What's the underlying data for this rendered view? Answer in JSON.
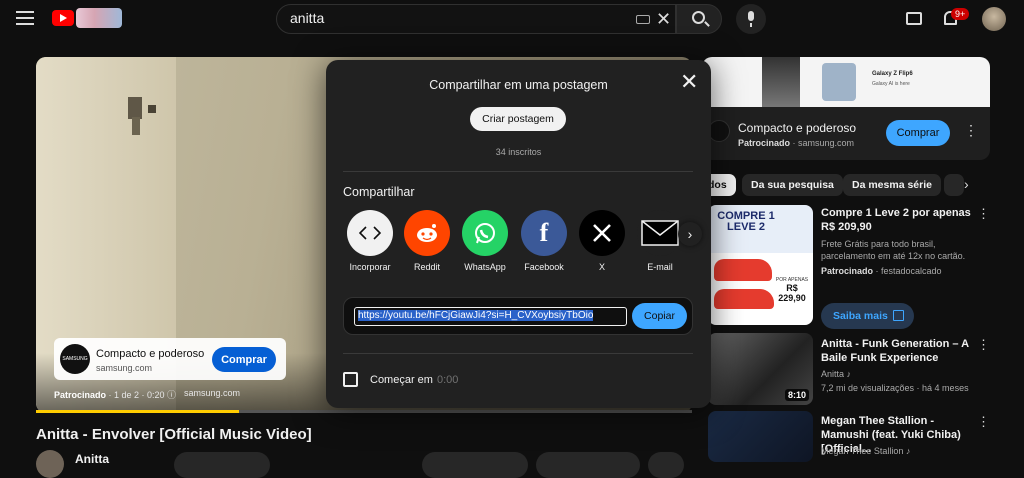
{
  "header": {
    "search_value": "anitta",
    "notification_count": "9+"
  },
  "video": {
    "title": "Anitta - Envolver [Official Music Video]",
    "channel": "Anitta",
    "progress_fraction": 0.31,
    "ad": {
      "logo_text": "SAMSUNG",
      "title": "Compacto e poderoso",
      "domain": "samsung.com",
      "buy_label": "Comprar",
      "meta_sponsored": "Patrocinado",
      "meta_rest": " · 1 de 2 · 0:20 ⓘ",
      "meta_domain": "samsung.com"
    }
  },
  "share_modal": {
    "title": "Compartilhar em uma postagem",
    "create_post_label": "Criar postagem",
    "subscribers": "34 inscritos",
    "share_label": "Compartilhar",
    "targets": [
      {
        "name": "Incorporar",
        "icon": "embed-icon",
        "color": "#f1f1f1"
      },
      {
        "name": "Reddit",
        "icon": "reddit-icon",
        "color": "#ff4500"
      },
      {
        "name": "WhatsApp",
        "icon": "whatsapp-icon",
        "color": "#25d366"
      },
      {
        "name": "Facebook",
        "icon": "facebook-icon",
        "color": "#3b5998"
      },
      {
        "name": "X",
        "icon": "x-icon",
        "color": "#000000"
      },
      {
        "name": "E-mail",
        "icon": "email-icon",
        "color": "#212121"
      }
    ],
    "url": "https://youtu.be/hFCjGiawJi4?si=H_CVXoybsiyTbOio",
    "copy_label": "Copiar",
    "start_at_label": "Começar em",
    "start_at_value": "0:00"
  },
  "sidebar": {
    "banner_brand": "Galaxy Z Flip6",
    "banner_tagline": "Galaxy AI is here",
    "ad_title": "Compacto e poderoso",
    "ad_sponsored": "Patrocinado",
    "ad_domain": " · samsung.com",
    "ad_buy_label": "Comprar",
    "chips": [
      "dos",
      "Da sua pesquisa",
      "Da mesma série"
    ],
    "videos": [
      {
        "title": "Compre 1 Leve 2 por apenas R$ 209,90",
        "desc": "Frete Grátis para todo brasil, parcelamento em até 12x no cartão.",
        "meta_sponsored": "Patrocinado",
        "meta_rest": " · festadocalcado",
        "thumb_headline": "COMPRE 1 LEVE 2",
        "thumb_price_prefix": "POR APENAS",
        "thumb_price": "R$ 229,90",
        "cta": "Saiba mais"
      },
      {
        "title": "Anitta - Funk Generation – A Baile Funk Experience",
        "channel": "Anitta ♪",
        "meta": "7,2 mi de visualizações · há 4 meses",
        "duration": "8:10"
      },
      {
        "title": "Megan Thee Stallion - Mamushi (feat. Yuki Chiba) [Official...",
        "channel": "Megan Thee Stallion ♪"
      }
    ]
  }
}
